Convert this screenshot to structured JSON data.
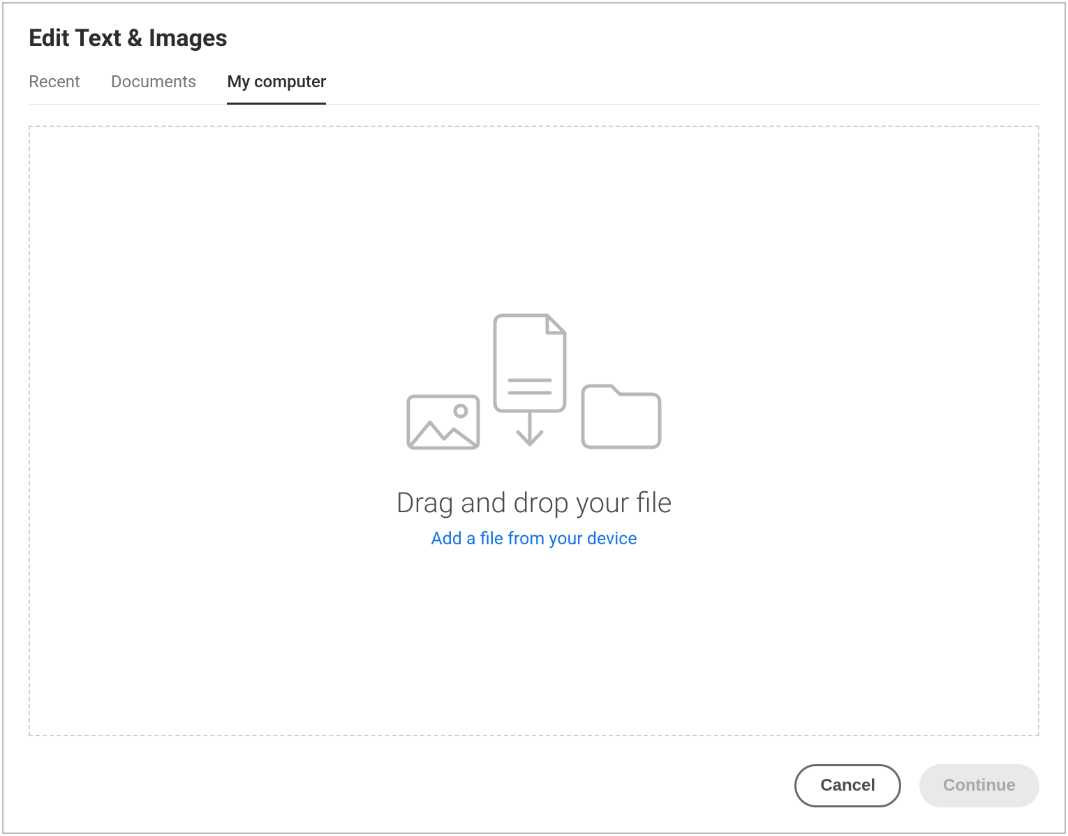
{
  "header": {
    "title": "Edit Text & Images"
  },
  "tabs": [
    {
      "label": "Recent",
      "active": false
    },
    {
      "label": "Documents",
      "active": false
    },
    {
      "label": "My computer",
      "active": true
    }
  ],
  "dropzone": {
    "main_text": "Drag and drop your file",
    "link_text": "Add a file from your device"
  },
  "footer": {
    "cancel_label": "Cancel",
    "continue_label": "Continue",
    "continue_enabled": false
  },
  "colors": {
    "link": "#1473e6",
    "text_primary": "#2c2c2c",
    "text_secondary": "#747474",
    "icon_stroke": "#b8b8b8",
    "border_dashed": "#cfcfcf"
  }
}
